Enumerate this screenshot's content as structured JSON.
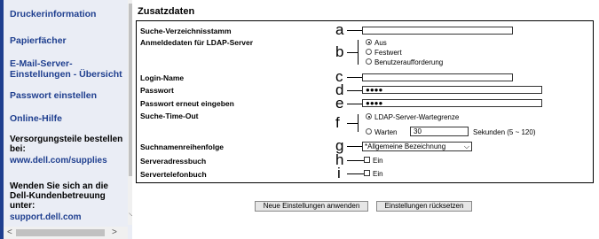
{
  "sidebar": {
    "printer_info": "Druckerinformation",
    "paper_trays": "Papierfächer",
    "email_line1": "E-Mail-Server-",
    "email_line2": "Einstellungen - Übersicht",
    "password": "Passwort einstellen",
    "help": "Online-Hilfe",
    "supplies_text": "Versorgungsteile bestellen bei:",
    "supplies_link": "www.dell.com/supplies",
    "support_text": "Wenden Sie sich an die Dell-Kundenbetreuung unter:",
    "support_link": "support.dell.com"
  },
  "main": {
    "title": "Zusatzdaten",
    "rows": {
      "a": {
        "letter": "a",
        "label": "Suche-Verzeichnisstamm",
        "value": ""
      },
      "b": {
        "letter": "b",
        "label": "Anmeldedaten für LDAP-Server",
        "options": [
          "Aus",
          "Festwert",
          "Benutzeraufforderung"
        ],
        "selected": "Aus"
      },
      "c": {
        "letter": "c",
        "label": "Login-Name",
        "value": ""
      },
      "d": {
        "letter": "d",
        "label": "Passwort",
        "value": "●●●●"
      },
      "e": {
        "letter": "e",
        "label": "Passwort erneut eingeben",
        "value": "●●●●"
      },
      "f": {
        "letter": "f",
        "label": "Suche-Time-Out",
        "option1": "LDAP-Server-Wartegrenze",
        "option2": "Warten",
        "value": "30",
        "unit": "Sekunden (5 ~ 120)",
        "selected": "LDAP-Server-Wartegrenze"
      },
      "g": {
        "letter": "g",
        "label": "Suchnamenreihenfolge",
        "value": "*Allgemeine Bezeichnung"
      },
      "h": {
        "letter": "h",
        "label": "Serveradressbuch",
        "check": "Ein",
        "checked": false
      },
      "i": {
        "letter": "i",
        "label": "Servertelefonbuch",
        "check": "Ein",
        "checked": false
      }
    },
    "apply_button": "Neue Einstellungen anwenden",
    "reset_button": "Einstellungen rücksetzen"
  }
}
